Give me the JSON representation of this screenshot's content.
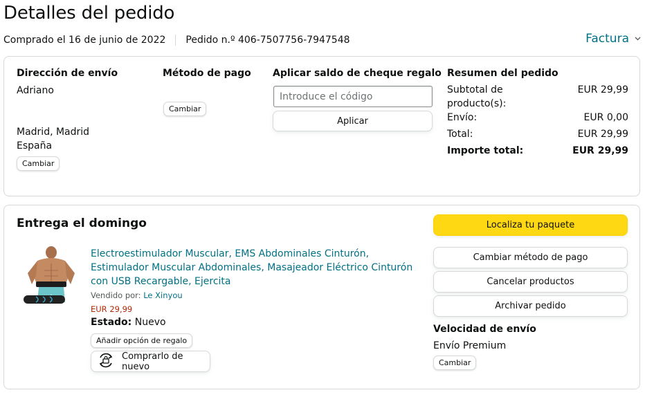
{
  "header": {
    "title": "Detalles del pedido",
    "purchase_date": "Comprado el 16 de junio de 2022",
    "order_number": "Pedido n.º 406-7507756-7947548",
    "invoice_label": "Factura"
  },
  "shipping": {
    "heading": "Dirección de envío",
    "name": "Adriano",
    "city": "Madrid, Madrid",
    "country": "España",
    "change_label": "Cambiar"
  },
  "payment": {
    "heading": "Método de pago",
    "change_label": "Cambiar"
  },
  "gift_card": {
    "heading": "Aplicar saldo de cheque regalo",
    "placeholder": "Introduce el código",
    "apply_label": "Aplicar"
  },
  "summary": {
    "heading": "Resumen del pedido",
    "rows": [
      {
        "label": "Subtotal de producto(s):",
        "value": "EUR 29,99"
      },
      {
        "label": "Envío:",
        "value": "EUR 0,00"
      },
      {
        "label": "Total:",
        "value": "EUR 29,99"
      },
      {
        "label": "Importe total:",
        "value": "EUR 29,99"
      }
    ]
  },
  "delivery": {
    "heading": "Entrega el domingo",
    "product_title": "Electroestimulador Muscular, EMS Abdominales Cinturón, Estimulador Muscular Abdominales, Masajeador Eléctrico Cinturón con USB Recargable, Ejercita",
    "sold_by_label": "Vendido por:",
    "seller": "Le Xinyou",
    "price": "EUR 29,99",
    "state_label": "Estado:",
    "state_value": "Nuevo",
    "gift_option_label": "Añadir opción de regalo",
    "buy_again_label": "Comprarlo de nuevo"
  },
  "actions": {
    "track": "Localiza tu paquete",
    "change_payment": "Cambiar método de pago",
    "cancel": "Cancelar productos",
    "archive": "Archivar pedido"
  },
  "shipping_speed": {
    "heading": "Velocidad de envío",
    "value": "Envío Premium",
    "change_label": "Cambiar"
  },
  "colors": {
    "link": "#007185",
    "price": "#b12704",
    "primary_button": "#ffd814",
    "border": "#d5d9d9"
  },
  "icons": {
    "invoice_dropdown": "chevron-down-icon",
    "buy_again": "reorder-icon"
  }
}
